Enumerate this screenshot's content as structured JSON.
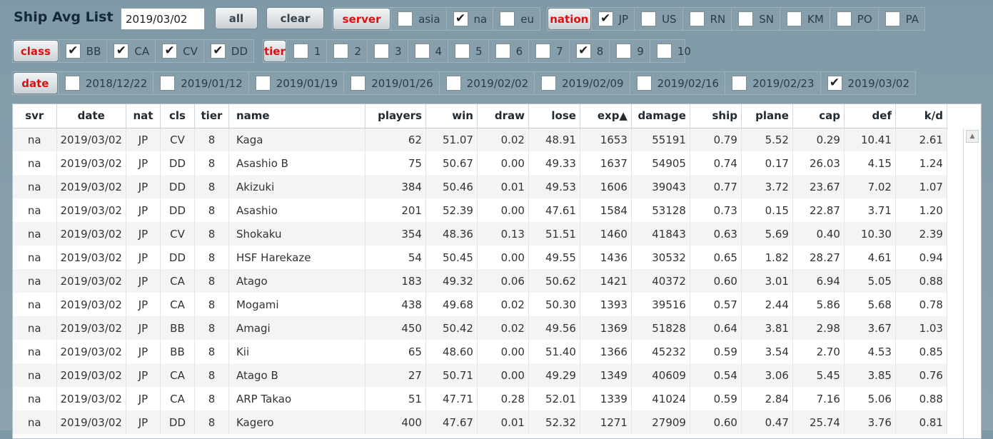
{
  "title": "Ship Avg List",
  "date_input": {
    "value": "2019/03/02"
  },
  "buttons": {
    "all": "all",
    "clear": "clear",
    "server": "server",
    "nation": "nation",
    "class": "class",
    "tier": "tier",
    "date": "date"
  },
  "colors": {
    "accent": "#dd1010",
    "background": "#8da2ad"
  },
  "server_options": [
    {
      "label": "asia",
      "checked": false
    },
    {
      "label": "na",
      "checked": true
    },
    {
      "label": "eu",
      "checked": false
    }
  ],
  "nation_options": [
    {
      "label": "JP",
      "checked": true
    },
    {
      "label": "US",
      "checked": false
    },
    {
      "label": "RN",
      "checked": false
    },
    {
      "label": "SN",
      "checked": false
    },
    {
      "label": "KM",
      "checked": false
    },
    {
      "label": "PO",
      "checked": false
    },
    {
      "label": "PA",
      "checked": false
    }
  ],
  "class_options": [
    {
      "label": "BB",
      "checked": true
    },
    {
      "label": "CA",
      "checked": true
    },
    {
      "label": "CV",
      "checked": true
    },
    {
      "label": "DD",
      "checked": true
    }
  ],
  "tier_options": [
    {
      "label": "1",
      "checked": false
    },
    {
      "label": "2",
      "checked": false
    },
    {
      "label": "3",
      "checked": false
    },
    {
      "label": "4",
      "checked": false
    },
    {
      "label": "5",
      "checked": false
    },
    {
      "label": "6",
      "checked": false
    },
    {
      "label": "7",
      "checked": false
    },
    {
      "label": "8",
      "checked": true
    },
    {
      "label": "9",
      "checked": false
    },
    {
      "label": "10",
      "checked": false
    }
  ],
  "date_options": [
    {
      "label": "2018/12/22",
      "checked": false
    },
    {
      "label": "2019/01/12",
      "checked": false
    },
    {
      "label": "2019/01/19",
      "checked": false
    },
    {
      "label": "2019/01/26",
      "checked": false
    },
    {
      "label": "2019/02/02",
      "checked": false
    },
    {
      "label": "2019/02/09",
      "checked": false
    },
    {
      "label": "2019/02/16",
      "checked": false
    },
    {
      "label": "2019/02/23",
      "checked": false
    },
    {
      "label": "2019/03/02",
      "checked": true
    }
  ],
  "table": {
    "columns": [
      "svr",
      "date",
      "nat",
      "cls",
      "tier",
      "name",
      "players",
      "win",
      "draw",
      "lose",
      "exp▲",
      "damage",
      "ship",
      "plane",
      "cap",
      "def",
      "k/d"
    ],
    "rows": [
      [
        "na",
        "2019/03/02",
        "JP",
        "CV",
        "8",
        "Kaga",
        "62",
        "51.07",
        "0.02",
        "48.91",
        "1653",
        "55191",
        "0.79",
        "5.52",
        "0.29",
        "10.41",
        "2.61"
      ],
      [
        "na",
        "2019/03/02",
        "JP",
        "DD",
        "8",
        "Asashio B",
        "75",
        "50.67",
        "0.00",
        "49.33",
        "1637",
        "54905",
        "0.74",
        "0.17",
        "26.03",
        "4.15",
        "1.24"
      ],
      [
        "na",
        "2019/03/02",
        "JP",
        "DD",
        "8",
        "Akizuki",
        "384",
        "50.46",
        "0.01",
        "49.53",
        "1606",
        "39043",
        "0.77",
        "3.72",
        "23.67",
        "7.02",
        "1.07"
      ],
      [
        "na",
        "2019/03/02",
        "JP",
        "DD",
        "8",
        "Asashio",
        "201",
        "52.39",
        "0.00",
        "47.61",
        "1584",
        "53128",
        "0.73",
        "0.15",
        "22.87",
        "3.71",
        "1.20"
      ],
      [
        "na",
        "2019/03/02",
        "JP",
        "CV",
        "8",
        "Shokaku",
        "354",
        "48.36",
        "0.13",
        "51.51",
        "1460",
        "41843",
        "0.63",
        "5.69",
        "0.40",
        "10.30",
        "2.39"
      ],
      [
        "na",
        "2019/03/02",
        "JP",
        "DD",
        "8",
        "HSF Harekaze",
        "54",
        "50.45",
        "0.00",
        "49.55",
        "1436",
        "30532",
        "0.65",
        "1.82",
        "28.27",
        "4.61",
        "0.94"
      ],
      [
        "na",
        "2019/03/02",
        "JP",
        "CA",
        "8",
        "Atago",
        "183",
        "49.32",
        "0.06",
        "50.62",
        "1421",
        "40372",
        "0.60",
        "3.01",
        "6.94",
        "5.05",
        "0.88"
      ],
      [
        "na",
        "2019/03/02",
        "JP",
        "CA",
        "8",
        "Mogami",
        "438",
        "49.68",
        "0.02",
        "50.30",
        "1393",
        "39516",
        "0.57",
        "2.44",
        "5.86",
        "5.68",
        "0.78"
      ],
      [
        "na",
        "2019/03/02",
        "JP",
        "BB",
        "8",
        "Amagi",
        "450",
        "50.42",
        "0.02",
        "49.56",
        "1369",
        "51828",
        "0.64",
        "3.81",
        "2.98",
        "3.67",
        "1.03"
      ],
      [
        "na",
        "2019/03/02",
        "JP",
        "BB",
        "8",
        "Kii",
        "65",
        "48.60",
        "0.00",
        "51.40",
        "1366",
        "45232",
        "0.59",
        "3.54",
        "2.70",
        "4.53",
        "0.85"
      ],
      [
        "na",
        "2019/03/02",
        "JP",
        "CA",
        "8",
        "Atago B",
        "27",
        "50.71",
        "0.00",
        "49.29",
        "1349",
        "40609",
        "0.54",
        "3.06",
        "5.45",
        "3.85",
        "0.76"
      ],
      [
        "na",
        "2019/03/02",
        "JP",
        "CA",
        "8",
        "ARP Takao",
        "51",
        "47.71",
        "0.28",
        "52.01",
        "1339",
        "41024",
        "0.59",
        "2.84",
        "7.16",
        "5.06",
        "0.88"
      ],
      [
        "na",
        "2019/03/02",
        "JP",
        "DD",
        "8",
        "Kagero",
        "400",
        "47.67",
        "0.01",
        "52.32",
        "1271",
        "27909",
        "0.60",
        "0.47",
        "25.74",
        "3.76",
        "0.81"
      ]
    ]
  }
}
